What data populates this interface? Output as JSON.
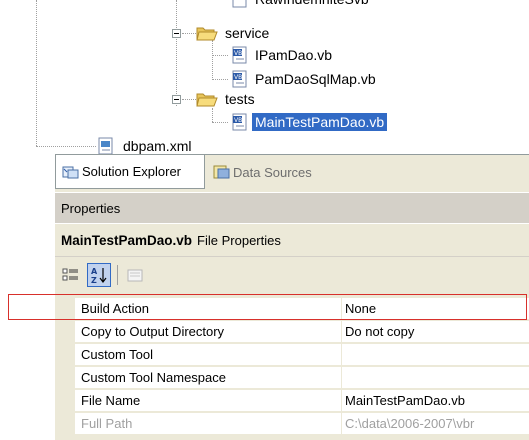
{
  "tree": {
    "items": [
      {
        "label": "RawIndemniteSvb",
        "icon": "vb-file-icon"
      },
      {
        "label": "service",
        "icon": "folder-open-icon",
        "expanded": true
      },
      {
        "label": "IPamDao.vb",
        "icon": "vb-file-icon"
      },
      {
        "label": "PamDaoSqlMap.vb",
        "icon": "vb-file-icon"
      },
      {
        "label": "tests",
        "icon": "folder-open-icon",
        "expanded": true
      },
      {
        "label": "MainTestPamDao.vb",
        "icon": "vb-file-icon",
        "selected": true
      },
      {
        "label": "dbpam.xml",
        "icon": "xml-file-icon"
      }
    ]
  },
  "tabs": [
    {
      "label": "Solution Explorer",
      "icon": "solution-explorer-icon",
      "active": true
    },
    {
      "label": "Data Sources",
      "icon": "data-sources-icon",
      "active": false
    }
  ],
  "properties": {
    "title": "Properties",
    "object_name": "MainTestPamDao.vb",
    "object_type": "File Properties",
    "toolbar": [
      {
        "icon": "categorized-icon"
      },
      {
        "icon": "alphabetical-sort-icon",
        "selected": true
      },
      {
        "icon": "property-pages-icon",
        "enabled": false
      }
    ],
    "rows": [
      {
        "name": "Build Action",
        "value": "None"
      },
      {
        "name": "Copy to Output Directory",
        "value": "Do not copy"
      },
      {
        "name": "Custom Tool",
        "value": ""
      },
      {
        "name": "Custom Tool Namespace",
        "value": ""
      },
      {
        "name": "File Name",
        "value": "MainTestPamDao.vb"
      },
      {
        "name": "Full Path",
        "value": "C:\\data\\2006-2007\\vbr",
        "dim": true
      }
    ]
  },
  "colors": {
    "selection": "#316ac5",
    "highlight_box": "#d8302b",
    "panel_bg": "#ece9d8"
  }
}
